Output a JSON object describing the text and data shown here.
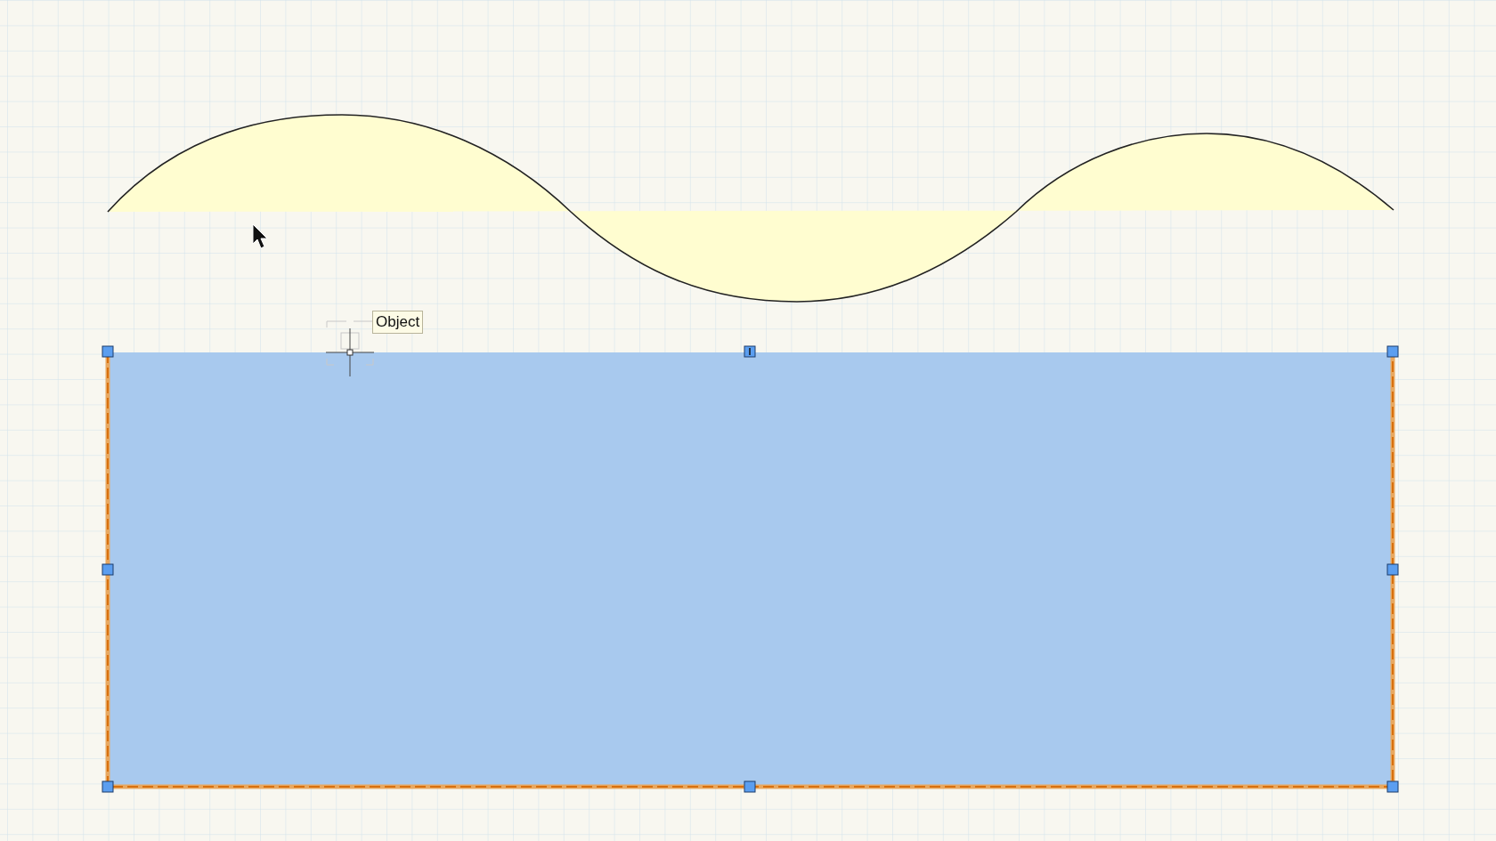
{
  "shapes": [
    {
      "kind": "wave"
    },
    {
      "kind": "rectangle",
      "selected": true
    }
  ],
  "tooltip": {
    "label": "Object"
  }
}
